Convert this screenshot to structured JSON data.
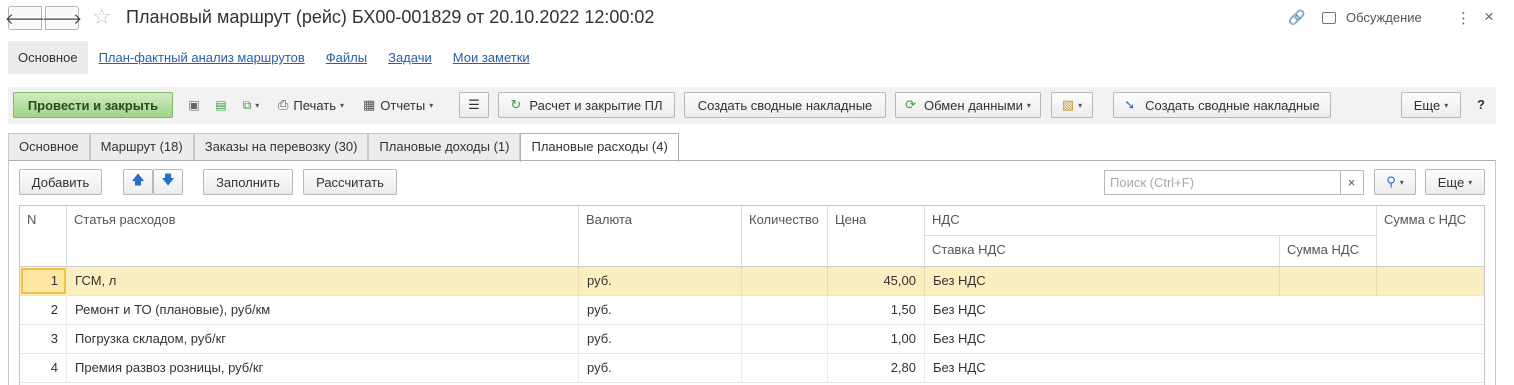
{
  "title_bar": {
    "back_icon": "arrow-left-icon",
    "forward_icon": "arrow-right-icon",
    "favorite_icon": "star-icon",
    "title": "Плановый маршрут (рейс) БХ00-001829 от 20.10.2022 12:00:02",
    "link_icon": "link-icon",
    "discuss_label": "Обсуждение",
    "more_icon": "kebab-icon",
    "close_icon": "close-icon"
  },
  "section_nav": {
    "active": "Основное",
    "links": [
      "План-фактный анализ маршрутов",
      "Файлы",
      "Задачи",
      "Мои заметки"
    ]
  },
  "command_bar": {
    "post_close": "Провести и закрыть",
    "print": "Печать",
    "reports": "Отчеты",
    "calc_close_pl": "Расчет и закрытие ПЛ",
    "create_summary_1": "Создать сводные накладные",
    "exchange": "Обмен данными",
    "create_summary_2": "Создать сводные накладные",
    "more": "Еще",
    "help": "?"
  },
  "tabs": [
    {
      "label": "Основное",
      "active": false
    },
    {
      "label": "Маршрут (18)",
      "active": false
    },
    {
      "label": "Заказы на перевозку (30)",
      "active": false
    },
    {
      "label": "Плановые доходы (1)",
      "active": false
    },
    {
      "label": "Плановые расходы (4)",
      "active": true
    }
  ],
  "table_toolbar": {
    "add": "Добавить",
    "fill": "Заполнить",
    "calculate": "Рассчитать",
    "search_placeholder": "Поиск (Ctrl+F)",
    "clear": "×",
    "more": "Еще"
  },
  "table": {
    "headers": {
      "n": "N",
      "expense_item": "Статья расходов",
      "currency": "Валюта",
      "quantity": "Количество",
      "price": "Цена",
      "vat": "НДС",
      "vat_rate": "Ставка НДС",
      "vat_amount": "Сумма НДС",
      "sum_with_vat": "Сумма с НДС"
    },
    "rows": [
      {
        "n": "1",
        "item": "ГСМ, л",
        "currency": "руб.",
        "quantity": "",
        "price": "45,00",
        "vat_rate": "Без НДС",
        "vat_amount": "",
        "sum": ""
      },
      {
        "n": "2",
        "item": "Ремонт и ТО (плановые), руб/км",
        "currency": "руб.",
        "quantity": "",
        "price": "1,50",
        "vat_rate": "Без НДС",
        "vat_amount": "",
        "sum": ""
      },
      {
        "n": "3",
        "item": "Погрузка складом, руб/кг",
        "currency": "руб.",
        "quantity": "",
        "price": "1,00",
        "vat_rate": "Без НДС",
        "vat_amount": "",
        "sum": ""
      },
      {
        "n": "4",
        "item": "Премия развоз розницы, руб/кг",
        "currency": "руб.",
        "quantity": "",
        "price": "2,80",
        "vat_rate": "Без НДС",
        "vat_amount": "",
        "sum": ""
      }
    ],
    "selected_row": 0
  },
  "colors": {
    "primary_button": "#9fd38a",
    "link": "#2a5fa8",
    "selected_row": "#fbefc1"
  }
}
